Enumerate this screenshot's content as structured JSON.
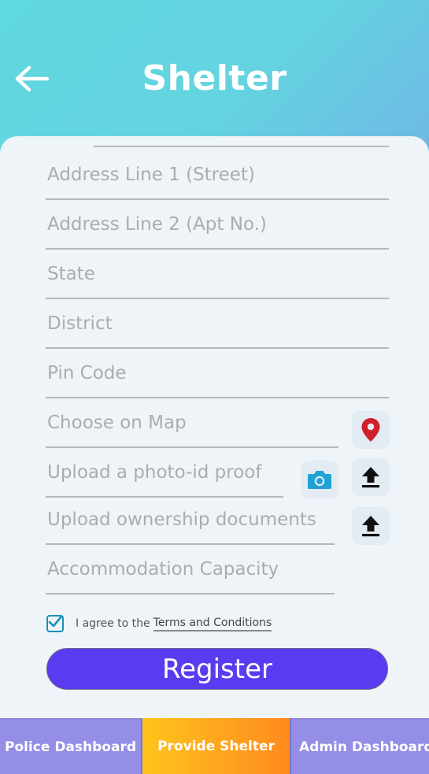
{
  "header": {
    "title": "Shelter",
    "back_icon": "arrow-left-icon"
  },
  "form": {
    "address1_placeholder": "Address Line 1 (Street)",
    "address2_placeholder": "Address Line 2 (Apt No.)",
    "state_placeholder": "State",
    "district_placeholder": "District",
    "pincode_placeholder": "Pin Code",
    "map_placeholder": "Choose on Map",
    "photo_id_placeholder": "Upload a photo-id proof",
    "ownership_placeholder": "Upload ownership documents",
    "capacity_placeholder": "Accommodation Capacity",
    "icons": {
      "map": "map-pin-icon",
      "camera": "camera-icon",
      "upload": "upload-icon"
    },
    "terms_prefix": "I agree to the",
    "terms_link": "Terms and Conditions",
    "terms_checked": true,
    "register_label": "Register"
  },
  "bottom_nav": {
    "tabs": [
      {
        "label": "Police Dashboard",
        "active": false
      },
      {
        "label": "Provide Shelter",
        "active": true
      },
      {
        "label": "Admin Dashboard",
        "active": false
      }
    ]
  },
  "colors": {
    "header_gradient_start": "#5fd8df",
    "header_gradient_end": "#6fb7e6",
    "card_bg": "#eff4f8",
    "register_button": "#5b3bef",
    "nav_inactive": "#958ee6",
    "nav_active_start": "#ffc41c",
    "nav_active_end": "#ff8a1f",
    "map_pin": "#d0202a",
    "camera": "#1fa3d6"
  }
}
